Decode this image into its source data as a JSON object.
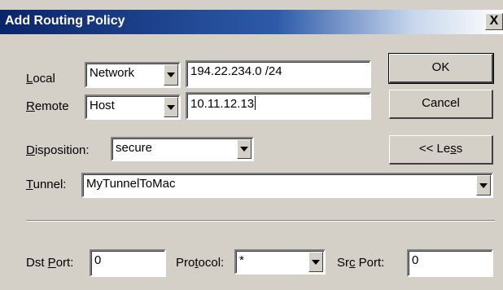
{
  "dialog": {
    "title": "Add Routing Policy",
    "close_glyph": "X"
  },
  "local": {
    "label_accel": "L",
    "label_rest": "ocal",
    "type": "Network",
    "address": "194.22.234.0  /24"
  },
  "remote": {
    "label_accel": "R",
    "label_rest": "emote",
    "type": "Host",
    "address": "10.11.12.13"
  },
  "disposition": {
    "label_accel": "D",
    "label_rest": "isposition:",
    "value": "secure"
  },
  "tunnel": {
    "label_accel": "T",
    "label_rest": "unnel:",
    "value": "MyTunnelToMac"
  },
  "dst_port": {
    "label_pre": "Dst ",
    "label_accel": "P",
    "label_post": "ort:",
    "value": "0"
  },
  "protocol": {
    "label_pre": "Pro",
    "label_accel": "t",
    "label_post": "ocol:",
    "value": "*"
  },
  "src_port": {
    "label_pre": "Sr",
    "label_accel": "c",
    "label_post": " Port:",
    "value": "0"
  },
  "buttons": {
    "ok": "OK",
    "cancel": "Cancel",
    "less_pre": "<< Le",
    "less_accel": "s",
    "less_post": "s"
  },
  "icons": {
    "dropdown": "chevron-down-icon",
    "close": "close-icon"
  }
}
